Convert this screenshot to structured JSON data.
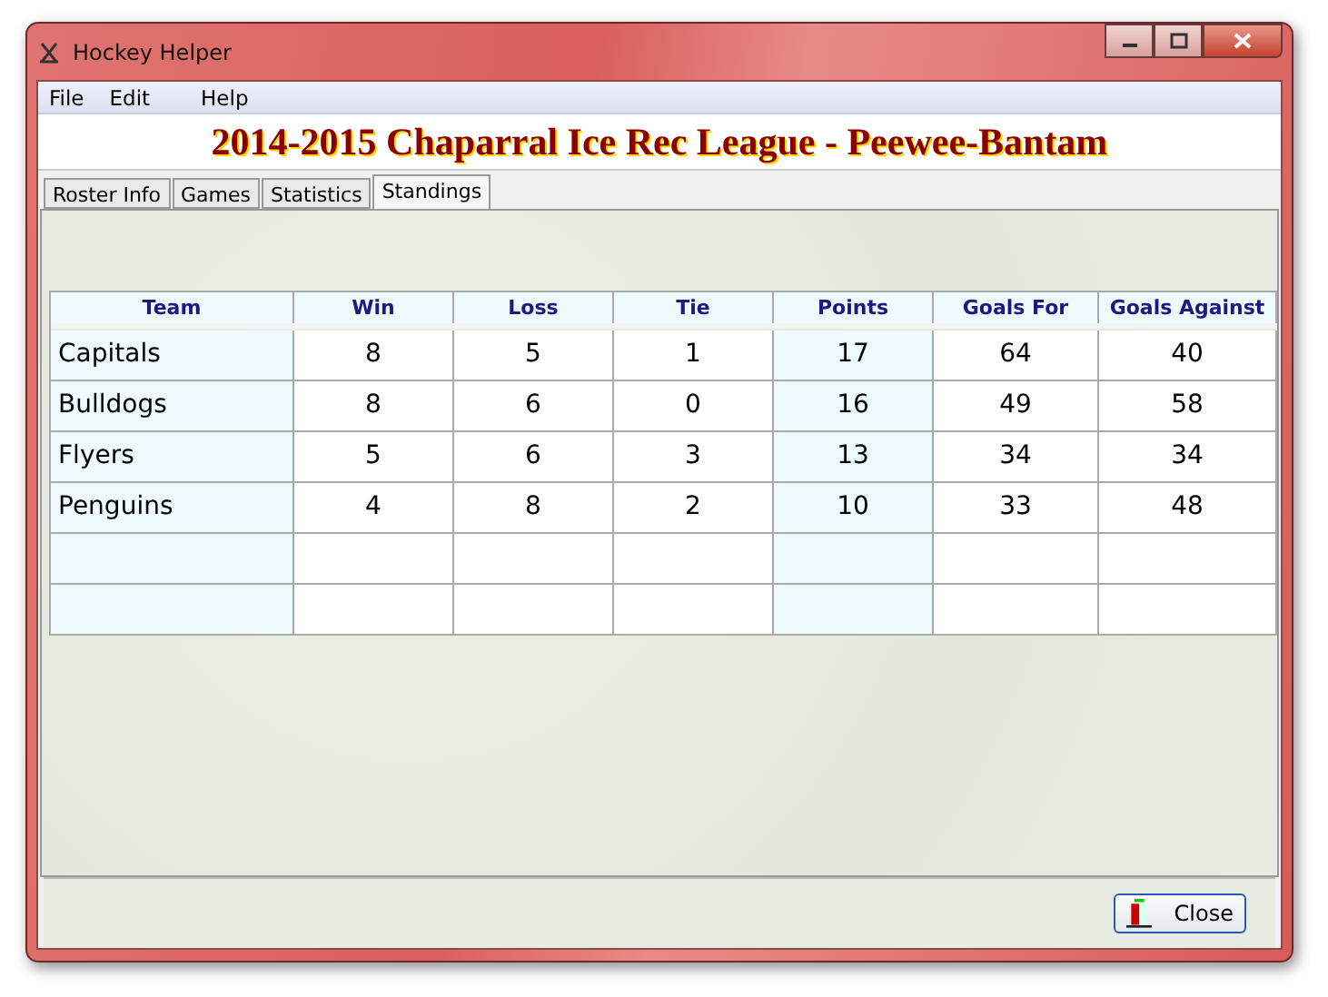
{
  "window": {
    "title": "Hockey Helper"
  },
  "menu": [
    "File",
    "Edit",
    "Help"
  ],
  "banner": "2014-2015 Chaparral Ice Rec League - Peewee-Bantam",
  "tabs": [
    {
      "label": "Roster Info",
      "selected": false
    },
    {
      "label": "Games",
      "selected": false
    },
    {
      "label": "Statistics",
      "selected": false
    },
    {
      "label": "Standings",
      "selected": true
    }
  ],
  "table": {
    "columns": [
      {
        "label": "Team",
        "highlighted": true
      },
      {
        "label": "Win",
        "highlighted": false
      },
      {
        "label": "Loss",
        "highlighted": false
      },
      {
        "label": "Tie",
        "highlighted": false
      },
      {
        "label": "Points",
        "highlighted": true
      },
      {
        "label": "Goals For",
        "highlighted": false
      },
      {
        "label": "Goals Against",
        "highlighted": false
      }
    ],
    "rows": [
      [
        "Capitals",
        "8",
        "5",
        "1",
        "17",
        "64",
        "40"
      ],
      [
        "Bulldogs",
        "8",
        "6",
        "0",
        "16",
        "49",
        "58"
      ],
      [
        "Flyers",
        "5",
        "6",
        "3",
        "13",
        "34",
        "34"
      ],
      [
        "Penguins",
        "4",
        "8",
        "2",
        "10",
        "33",
        "48"
      ]
    ]
  },
  "close_button": "Close"
}
